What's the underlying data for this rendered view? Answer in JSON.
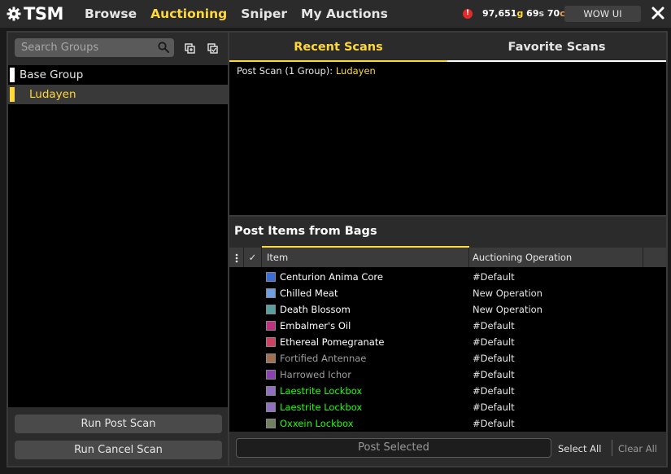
{
  "app": {
    "logo_text": "TSM"
  },
  "nav": [
    {
      "label": "Browse",
      "active": false
    },
    {
      "label": "Auctioning",
      "active": true
    },
    {
      "label": "Sniper",
      "active": false
    },
    {
      "label": "My Auctions",
      "active": false
    }
  ],
  "header": {
    "gold": "97,651",
    "gold_unit": "g",
    "silver": "69",
    "silver_unit": "s",
    "copper": "70",
    "copper_unit": "c",
    "wowui_label": "WOW UI"
  },
  "sidebar": {
    "search_placeholder": "Search Groups",
    "groups": [
      {
        "label": "Base Group"
      },
      {
        "label": "Ludayen"
      }
    ],
    "run_post_label": "Run Post Scan",
    "run_cancel_label": "Run Cancel Scan"
  },
  "scans": {
    "tabs": [
      {
        "label": "Recent Scans",
        "active": true
      },
      {
        "label": "Favorite Scans",
        "active": false
      }
    ],
    "entry_prefix": "Post Scan (1 Group): ",
    "entry_group": "Ludayen"
  },
  "post_items": {
    "title": "Post Items from Bags",
    "columns": {
      "check": "✓",
      "item": "Item",
      "operation": "Auctioning Operation"
    },
    "rows": [
      {
        "item": "Centurion Anima Core",
        "operation": "#Default",
        "color": "#ffffff",
        "icon_color": "#3b6dd8"
      },
      {
        "item": "Chilled Meat",
        "operation": "New Operation",
        "color": "#ffffff",
        "icon_color": "#6f9fe0"
      },
      {
        "item": "Death Blossom",
        "operation": "New Operation",
        "color": "#ffffff",
        "icon_color": "#5a9fa0"
      },
      {
        "item": "Embalmer's Oil",
        "operation": "#Default",
        "color": "#ffffff",
        "icon_color": "#c03080"
      },
      {
        "item": "Ethereal Pomegranate",
        "operation": "#Default",
        "color": "#ffffff",
        "icon_color": "#d04060"
      },
      {
        "item": "Fortified Antennae",
        "operation": "#Default",
        "color": "#9d9d9d",
        "icon_color": "#a07050"
      },
      {
        "item": "Harrowed Ichor",
        "operation": "#Default",
        "color": "#9d9d9d",
        "icon_color": "#8a40b0"
      },
      {
        "item": "Laestrite Lockbox",
        "operation": "#Default",
        "color": "#1eff00",
        "icon_color": "#9070c0"
      },
      {
        "item": "Laestrite Lockbox",
        "operation": "#Default",
        "color": "#1eff00",
        "icon_color": "#9070c0"
      },
      {
        "item": "Oxxein Lockbox",
        "operation": "#Default",
        "color": "#1eff00",
        "icon_color": "#708060"
      }
    ],
    "post_selected_label": "Post Selected",
    "select_all_label": "Select All",
    "clear_all_label": "Clear All"
  }
}
